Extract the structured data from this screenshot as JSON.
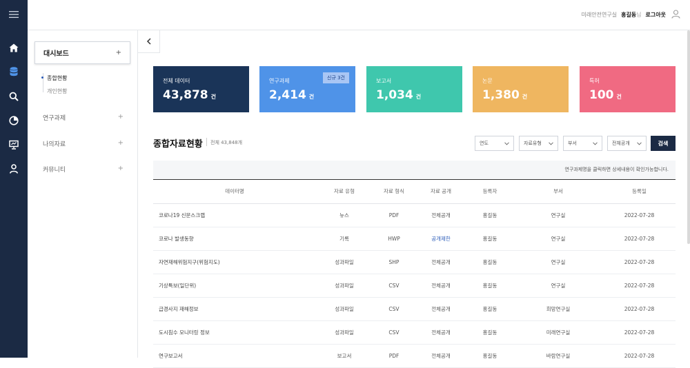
{
  "header": {
    "org": "미래안전연구실",
    "user": "홍길동",
    "honorific": "님",
    "logout": "로그아웃"
  },
  "nav": {
    "icons": [
      "menu-icon",
      "home-icon",
      "database-icon",
      "search-icon",
      "pie-chart-icon",
      "presentation-icon",
      "user-icon"
    ],
    "dashboard": "대시보드",
    "plus": "+",
    "sub": [
      "종합현황",
      "개인현황"
    ],
    "menus": [
      "연구과제",
      "나의자료",
      "커뮤니티"
    ]
  },
  "cards": [
    {
      "label": "전체 데이터",
      "value": "43,878",
      "unit": "건",
      "color": "#1a3458"
    },
    {
      "label": "연구과제",
      "value": "2,414",
      "unit": "건",
      "color": "#4f93e8",
      "badge": "신규 3건"
    },
    {
      "label": "보고서",
      "value": "1,034",
      "unit": "건",
      "color": "#3fc7ad"
    },
    {
      "label": "논문",
      "value": "1,380",
      "unit": "건",
      "color": "#efb660"
    },
    {
      "label": "특허",
      "value": "100",
      "unit": "건",
      "color": "#f06a82"
    }
  ],
  "section": {
    "title": "종합자료현황",
    "total": "전체 43,848개",
    "filters": [
      "연도",
      "자료유형",
      "부서",
      "전체공개"
    ],
    "search": "검색",
    "notice": "연구과제명을 클릭하면 상세내용이 확인가능합니다."
  },
  "table": {
    "headers": [
      "데이터명",
      "자료 유형",
      "자료 형식",
      "자료 공개",
      "등록자",
      "부서",
      "등록일"
    ],
    "rows": [
      [
        "코로나19 신문스크랩",
        "뉴스",
        "PDF",
        "전체공개",
        "홍길동",
        "연구실",
        "2022-07-28"
      ],
      [
        "코로나 발생동향",
        "기록",
        "HWP",
        "공개제한",
        "홍길동",
        "연구실",
        "2022-07-28"
      ],
      [
        "자연재해위험지구(위험지도)",
        "성과파일",
        "SHP",
        "전체공개",
        "홍길동",
        "연구실",
        "2022-07-28"
      ],
      [
        "기상특보(일단위)",
        "성과파일",
        "CSV",
        "전체공개",
        "홍길동",
        "연구실",
        "2022-07-28"
      ],
      [
        "급경사지 재해정보",
        "성과파일",
        "CSV",
        "전체공개",
        "홍길동",
        "희망연구실",
        "2022-07-28"
      ],
      [
        "도시침수 모니터링 정보",
        "성과파일",
        "CSV",
        "전체공개",
        "홍길동",
        "미래연구실",
        "2022-07-28"
      ],
      [
        "연구보고서",
        "보고서",
        "PDF",
        "전체공개",
        "홍길동",
        "바람연구실",
        "2022-07-28"
      ]
    ],
    "restricted_color": "#2a5bb8"
  }
}
